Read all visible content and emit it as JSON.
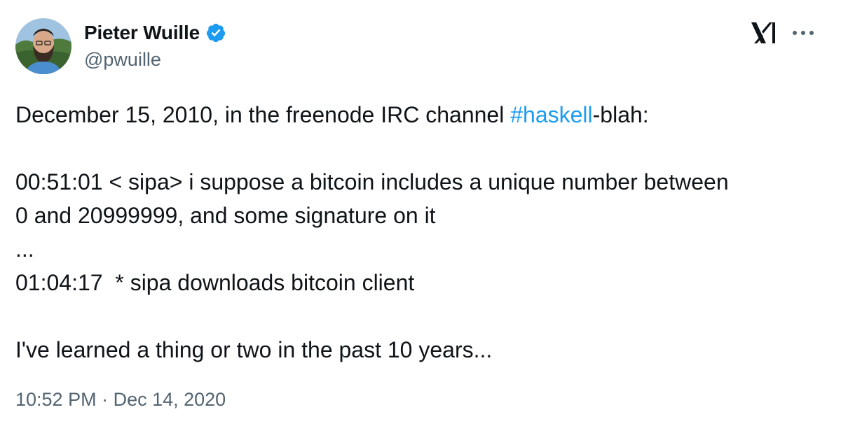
{
  "author": {
    "display_name": "Pieter Wuille",
    "handle": "@pwuille",
    "verified": true
  },
  "tweet": {
    "line1_prefix": "December 15, 2010, in the freenode IRC channel ",
    "hashtag": "#haskell",
    "line1_suffix": "-blah:",
    "log_line1": "00:51:01 < sipa> i suppose a bitcoin includes a unique number between",
    "log_line1_cont": "0 and 20999999, and some signature on it",
    "log_ellipsis": "...",
    "log_line2": "01:04:17  * sipa downloads bitcoin client",
    "closing": "I've learned a thing or two in the past 10 years..."
  },
  "meta": {
    "time": "10:52 PM",
    "separator": " · ",
    "date": "Dec 14, 2020"
  },
  "colors": {
    "link": "#1d9bf0",
    "text": "#0f1419",
    "secondary": "#536471"
  },
  "icons": {
    "verified": "verified-badge-icon",
    "platform": "x-logo-icon",
    "more": "more-dots-icon"
  }
}
